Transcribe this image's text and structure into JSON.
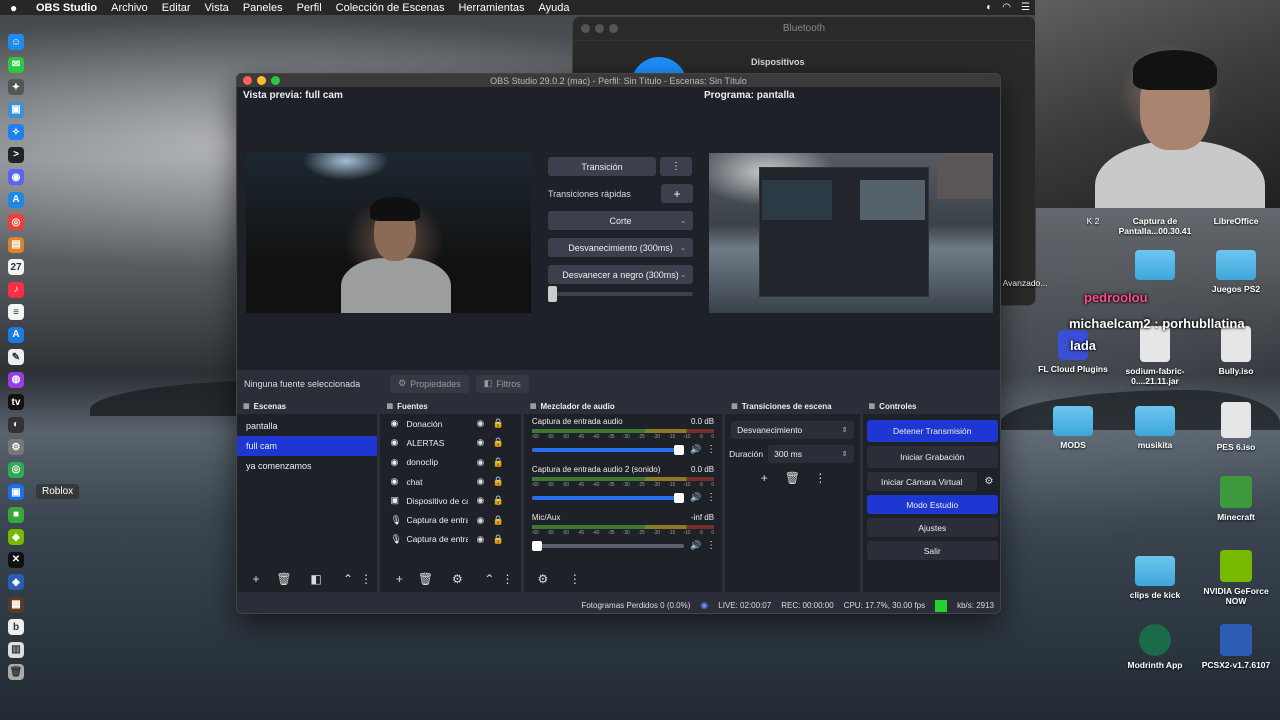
{
  "menubar": {
    "app": "OBS Studio",
    "items": [
      "Archivo",
      "Editar",
      "Vista",
      "Paneles",
      "Perfil",
      "Colección de Escenas",
      "Herramientas",
      "Ayuda"
    ]
  },
  "dock": {
    "tooltip": "Roblox",
    "icons": [
      {
        "name": "finder-icon",
        "color": "#1c8cf0",
        "glyph": "☺"
      },
      {
        "name": "messages-icon",
        "color": "#2ac940",
        "glyph": "✉"
      },
      {
        "name": "launchpad-icon",
        "color": "#555",
        "glyph": "✦"
      },
      {
        "name": "preview-icon",
        "color": "#3d8fd6",
        "glyph": "▣"
      },
      {
        "name": "safari-icon",
        "color": "#1e7ff0",
        "glyph": "✧"
      },
      {
        "name": "terminal-icon",
        "color": "#222",
        "glyph": ">"
      },
      {
        "name": "discord-icon",
        "color": "#5865f2",
        "glyph": "◉"
      },
      {
        "name": "appstore-icon",
        "color": "#1e88e5",
        "glyph": "A"
      },
      {
        "name": "chrome-icon",
        "color": "#e94235",
        "glyph": "◎"
      },
      {
        "name": "books-icon",
        "color": "#e0822c",
        "glyph": "▤"
      },
      {
        "name": "calendar-icon",
        "color": "#f4f4f4",
        "glyph": "27"
      },
      {
        "name": "music-icon",
        "color": "#fa2d48",
        "glyph": "♪"
      },
      {
        "name": "notes-icon",
        "color": "#f5f5f5",
        "glyph": "≡"
      },
      {
        "name": "xcode-icon",
        "color": "#1c7ae0",
        "glyph": "A"
      },
      {
        "name": "textedit-icon",
        "color": "#eee",
        "glyph": "✎"
      },
      {
        "name": "podcasts-icon",
        "color": "#9a3ce0",
        "glyph": "◍"
      },
      {
        "name": "appletv-icon",
        "color": "#111",
        "glyph": "tv"
      },
      {
        "name": "obs-icon",
        "color": "#333",
        "glyph": "◐"
      },
      {
        "name": "settings-icon",
        "color": "#777",
        "glyph": "⚙"
      },
      {
        "name": "chrome2-icon",
        "color": "#34a853",
        "glyph": "◎"
      },
      {
        "name": "roblox-icon",
        "color": "#1c6fe8",
        "glyph": "▣"
      },
      {
        "name": "minecraft-icon",
        "color": "#3aa73a",
        "glyph": "■"
      },
      {
        "name": "nvidia-icon",
        "color": "#76b900",
        "glyph": "◆"
      },
      {
        "name": "capcut-icon",
        "color": "#111",
        "glyph": "✕"
      },
      {
        "name": "pcsx2-icon",
        "color": "#2b5db5",
        "glyph": "◈"
      },
      {
        "name": "minecraft2-icon",
        "color": "#5a3c22",
        "glyph": "▦"
      },
      {
        "name": "bandlab-icon",
        "color": "#eee",
        "glyph": "b"
      },
      {
        "name": "downloads-icon",
        "color": "#ddd",
        "glyph": "▥"
      },
      {
        "name": "trash-icon",
        "color": "#aaa",
        "glyph": "🗑"
      }
    ]
  },
  "bluetooth": {
    "title": "Bluetooth",
    "subtitle": "Dispositivos"
  },
  "desktop": {
    "items": [
      {
        "label": "Captura de Pantalla...00.30.41",
        "kind": "file"
      },
      {
        "label": "LibreOffice",
        "kind": "folder"
      },
      {
        "label": "Juegos PS2",
        "kind": "folder"
      },
      {
        "label": "FL Cloud Plugins",
        "kind": "app"
      },
      {
        "label": "sodium-fabric-0....21.11.jar",
        "kind": "file"
      },
      {
        "label": "Bully.iso",
        "kind": "file"
      },
      {
        "label": "MODS",
        "kind": "folder"
      },
      {
        "label": "musikita",
        "kind": "folder"
      },
      {
        "label": "PES 6.iso",
        "kind": "file"
      },
      {
        "label": "Minecraft",
        "kind": "app"
      },
      {
        "label": "clips de kick",
        "kind": "folder"
      },
      {
        "label": "NVIDIA GeForce NOW",
        "kind": "app"
      },
      {
        "label": "Modrinth App",
        "kind": "app"
      },
      {
        "label": "PCSX2-v1.7.6107",
        "kind": "app"
      }
    ],
    "chat": {
      "line1": "pedroolou",
      "line2": "michaelcam2 : porhubllatina",
      "line3": "lada"
    },
    "snip_fragment": "Avanzado...",
    "k2": "K 2"
  },
  "obs": {
    "title": "OBS Studio 29.0.2 (mac) - Perfil: Sin Título - Escenas: Sin Título",
    "preview_label": "Vista previa: full cam",
    "program_label": "Programa: pantalla",
    "transition_button": "Transición",
    "quick_transitions": "Transiciones rápidas",
    "quick": [
      "Corte",
      "Desvanecimiento (300ms)",
      "Desvanecer a negro (300ms)"
    ],
    "no_source": "Ninguna fuente seleccionada",
    "properties": "Propiedades",
    "filters": "Filtros",
    "panels": {
      "scenes": "Escenas",
      "sources": "Fuentes",
      "mixer": "Mezclador de audio",
      "transitions": "Transiciones de escena",
      "controls": "Controles"
    },
    "scenes": [
      "pantalla",
      "full cam",
      "ya comenzamos"
    ],
    "selected_scene_index": 1,
    "sources": [
      {
        "name": "Donación",
        "icon": "browser-source-icon"
      },
      {
        "name": "ALERTAS",
        "icon": "browser-source-icon"
      },
      {
        "name": "donoclip",
        "icon": "browser-source-icon"
      },
      {
        "name": "chat",
        "icon": "browser-source-icon"
      },
      {
        "name": "Dispositivo de ca",
        "icon": "camera-source-icon"
      },
      {
        "name": "Captura de entra",
        "icon": "mic-source-icon"
      },
      {
        "name": "Captura de entra",
        "icon": "mic-source-icon"
      }
    ],
    "mixer": [
      {
        "name": "Captura de entrada audio",
        "db": "0.0 dB",
        "volume": 1.0
      },
      {
        "name": "Captura de entrada audio 2 (sonido)",
        "db": "0.0 dB",
        "volume": 1.0
      },
      {
        "name": "Mic/Aux",
        "db": "-inf dB",
        "volume": 0.0
      }
    ],
    "meter_ticks": [
      "-60",
      "-55",
      "-50",
      "-45",
      "-40",
      "-35",
      "-30",
      "-25",
      "-20",
      "-15",
      "-10",
      "-5",
      "0"
    ],
    "transition": {
      "selected": "Desvanecimiento",
      "duration_label": "Duración",
      "duration_value": "300 ms"
    },
    "controls": {
      "stop_stream": "Detener Transmisión",
      "start_recording": "Iniciar Grabación",
      "virtual_cam": "Iniciar Cámara Virtual",
      "studio_mode": "Modo Estudio",
      "settings": "Ajustes",
      "exit": "Salir"
    },
    "status": {
      "dropped": "Fotogramas Perdidos 0 (0.0%)",
      "live": "LIVE: 02:00:07",
      "rec": "REC: 00:00:00",
      "cpu": "CPU: 17.7%, 30.00 fps",
      "kbps": "kb/s: 2913"
    },
    "colors": {
      "accent": "#1e36d2",
      "background": "#1f2128",
      "panel": "#2b2e38",
      "stream_ok": "#25d12b"
    }
  }
}
